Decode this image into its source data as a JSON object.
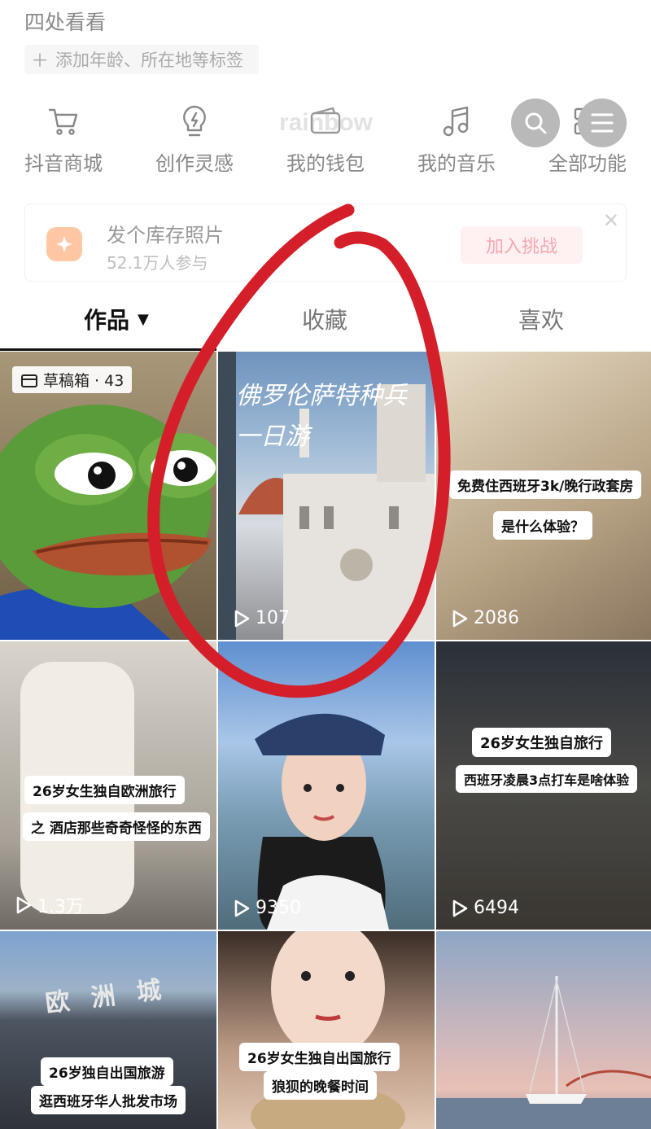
{
  "header": {
    "top_text": "四处看看",
    "tag_hint": "添加年龄、所在地等标签"
  },
  "watermark": "rainbow",
  "shortcuts": [
    {
      "label": "抖音商城",
      "icon": "cart-icon"
    },
    {
      "label": "创作灵感",
      "icon": "lightbulb-icon"
    },
    {
      "label": "我的钱包",
      "icon": "wallet-icon"
    },
    {
      "label": "我的音乐",
      "icon": "music-note-icon"
    },
    {
      "label": "全部功能",
      "icon": "grid-icon"
    }
  ],
  "banner": {
    "title": "发个库存照片",
    "subtitle": "52.1万人参与",
    "button": "加入挑战"
  },
  "tabs": [
    {
      "label": "作品",
      "active": true
    },
    {
      "label": "收藏",
      "active": false
    },
    {
      "label": "喜欢",
      "active": false
    }
  ],
  "videos": [
    {
      "draft": "草稿箱 · 43"
    },
    {
      "title_overlay": "佛罗伦萨特种兵一日游",
      "plays": "107"
    },
    {
      "caption1": "免费住西班牙3k/晚行政套房",
      "caption2": "是什么体验？",
      "plays": "2086"
    },
    {
      "caption1": "26岁女生独自欧洲旅行",
      "caption2": "之 酒店那些奇奇怪怪的东西",
      "plays": "1.3万"
    },
    {
      "plays": "9350"
    },
    {
      "caption1": "26岁女生独自旅行",
      "caption2": "西班牙凌晨3点打车是啥体验",
      "plays": "6494"
    },
    {
      "sign": "欧 洲 城",
      "caption1": "26岁独自出国旅游",
      "caption2": "逛西班牙华人批发市场"
    },
    {
      "caption1": "26岁女生独自出国旅行",
      "caption2": "狼狈的晚餐时间"
    },
    {}
  ],
  "colors": {
    "annotation": "#d41f2b",
    "challenge_button": "#f6a7b0"
  }
}
